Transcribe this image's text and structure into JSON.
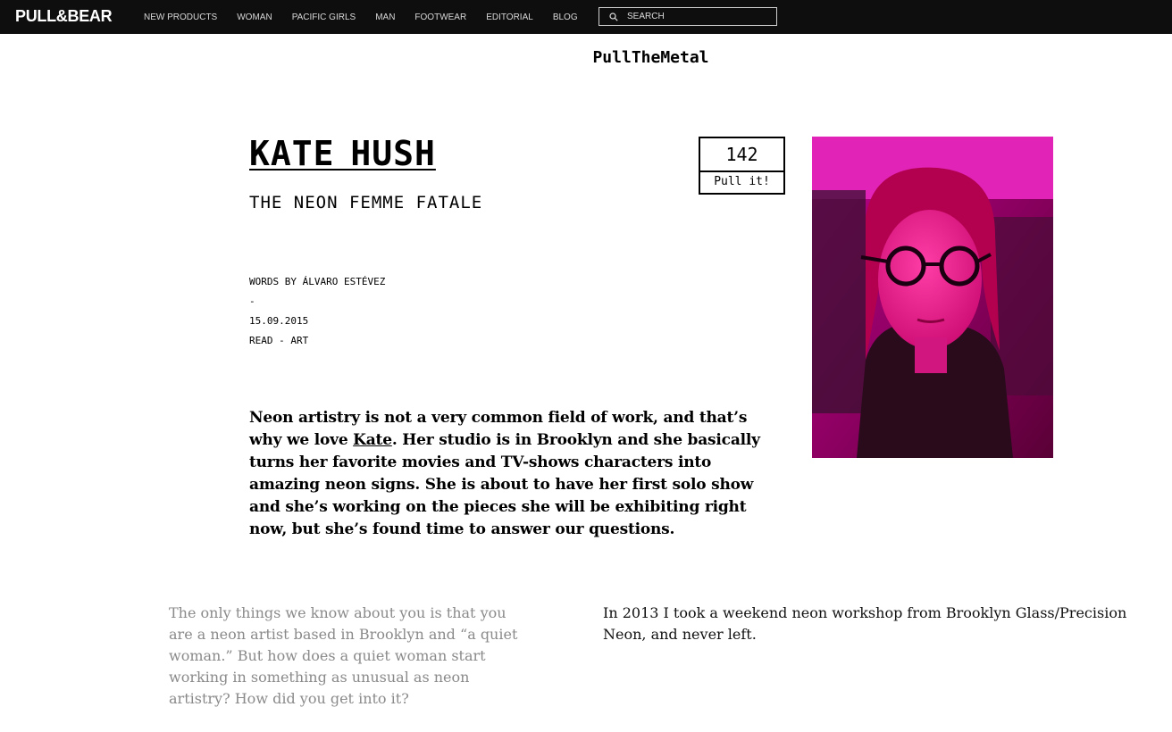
{
  "header": {
    "logo": "PULL&BEAR",
    "nav": [
      {
        "label": "NEW PRODUCTS"
      },
      {
        "label": "WOMAN"
      },
      {
        "label": "PACIFIC GIRLS"
      },
      {
        "label": "MAN"
      },
      {
        "label": "FOOTWEAR"
      },
      {
        "label": "EDITORIAL"
      },
      {
        "label": "BLOG"
      }
    ],
    "search": {
      "placeholder": "SEARCH",
      "icon": "search-icon"
    }
  },
  "site_title": "PullTheMetal",
  "article": {
    "title": "KATE HUSH",
    "subtitle": "THE NEON FEMME FATALE",
    "pull": {
      "count": "142",
      "button_label": "Pull it!"
    },
    "meta": {
      "byline": "WORDS BY ÁLVARO ESTÉVEZ",
      "separator": "-",
      "date": "15.09.2015",
      "category": "READ - ART"
    },
    "intro": {
      "before_link": "Neon artistry is not a very common field of work, and that’s why we love ",
      "link": "Kate",
      "after_link": ". Her studio is in Brooklyn and she basically turns her favorite movies and TV-shows characters into amazing neon signs. She is about to have her first solo show and she’s working on the pieces she will be exhibiting right now, but she’s found time to answer our questions."
    },
    "qa": [
      {
        "question": "The only things we know about you is that you are a neon artist based in Brooklyn and “a quiet woman.” But how does a quiet woman start working in something as unusual as neon artistry? How did you get into it?",
        "answer": "In 2013 I took a weekend neon workshop from Brooklyn Glass/Precision Neon, and never left."
      }
    ]
  },
  "colors": {
    "topbar": "#0e0e0e",
    "photo_accent": "#e0148c",
    "question_text": "#8a8a8a"
  }
}
